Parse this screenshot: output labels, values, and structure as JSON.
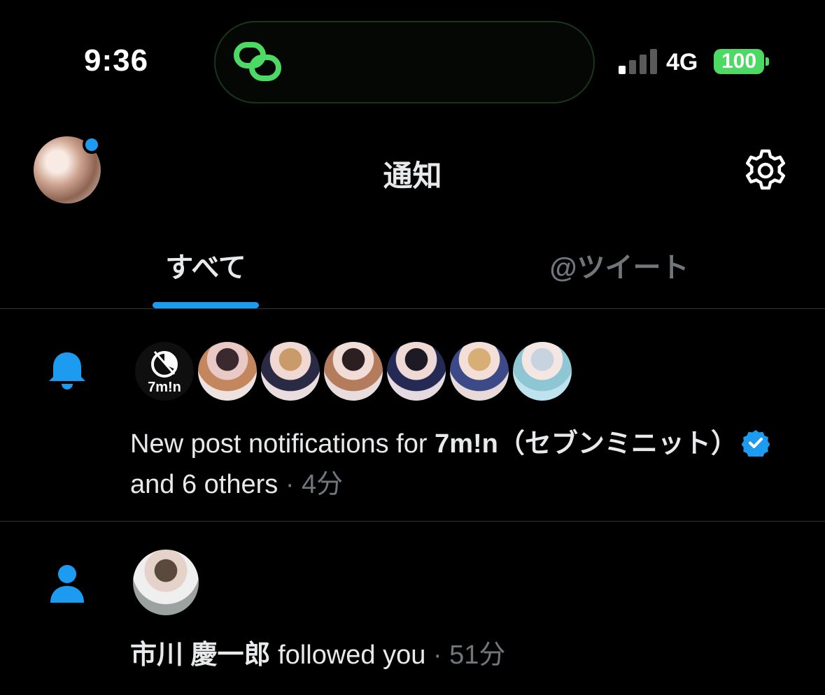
{
  "status_bar": {
    "time": "9:36",
    "network": "4G",
    "battery": "100",
    "island_icon": "link-chain-icon"
  },
  "header": {
    "title": "通知",
    "settings_icon": "gear-icon",
    "avatar_badge_color": "#1d9bf0"
  },
  "tabs": [
    {
      "label": "すべて",
      "active": true
    },
    {
      "label": "@ツイート",
      "active": false
    }
  ],
  "notifications": [
    {
      "icon": "bell-icon",
      "prefix": "New post notifications for ",
      "account": "7m!n（セブンミニット）",
      "suffix": " and 6 others",
      "time": " · 4分",
      "logo_text": "7m!n"
    },
    {
      "icon": "person-icon",
      "account": "市川 慶一郎",
      "suffix": " followed you",
      "time": " · 51分"
    }
  ],
  "colors": {
    "accent": "#1d9bf0",
    "island_icon": "#4cd964",
    "battery": "#4cd964",
    "muted_text": "#71767b"
  }
}
